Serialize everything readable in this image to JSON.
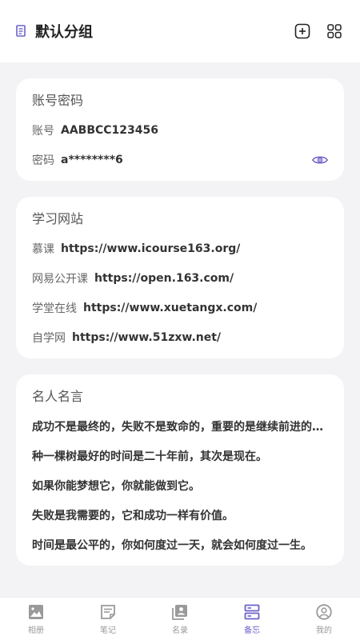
{
  "header": {
    "title": "默认分组",
    "add_icon": "plus-square-icon",
    "grid_icon": "grid-icon"
  },
  "cards": [
    {
      "title": "账号密码",
      "rows": [
        {
          "label": "账号",
          "value": "AABBCC123456"
        },
        {
          "label": "密码",
          "value": "a********6",
          "trailing_icon": "eye-icon"
        }
      ]
    },
    {
      "title": "学习网站",
      "rows": [
        {
          "label": "慕课",
          "value": "https://www.icourse163.org/"
        },
        {
          "label": "网易公开课",
          "value": "https://open.163.com/"
        },
        {
          "label": "学堂在线",
          "value": "https://www.xuetangx.com/"
        },
        {
          "label": "自学网",
          "value": "https://www.51zxw.net/"
        }
      ]
    },
    {
      "title": "名人名言",
      "quotes": [
        "成功不是最终的，失败不是致命的，重要的是继续前进的勇气。",
        "种一棵树最好的时间是二十年前，其次是现在。",
        "如果你能梦想它，你就能做到它。",
        "失败是我需要的，它和成功一样有价值。",
        "时间是最公平的，你如何度过一天，就会如何度过一生。"
      ]
    }
  ],
  "tabbar": {
    "tabs": [
      {
        "label": "相册",
        "icon": "image-icon"
      },
      {
        "label": "笔记",
        "icon": "note-icon"
      },
      {
        "label": "名录",
        "icon": "contacts-icon"
      },
      {
        "label": "备忘",
        "icon": "memo-icon",
        "active": true
      },
      {
        "label": "我的",
        "icon": "profile-icon"
      }
    ]
  },
  "colors": {
    "accent": "#6c63c8",
    "background": "#f3f3f5",
    "card": "#ffffff"
  }
}
